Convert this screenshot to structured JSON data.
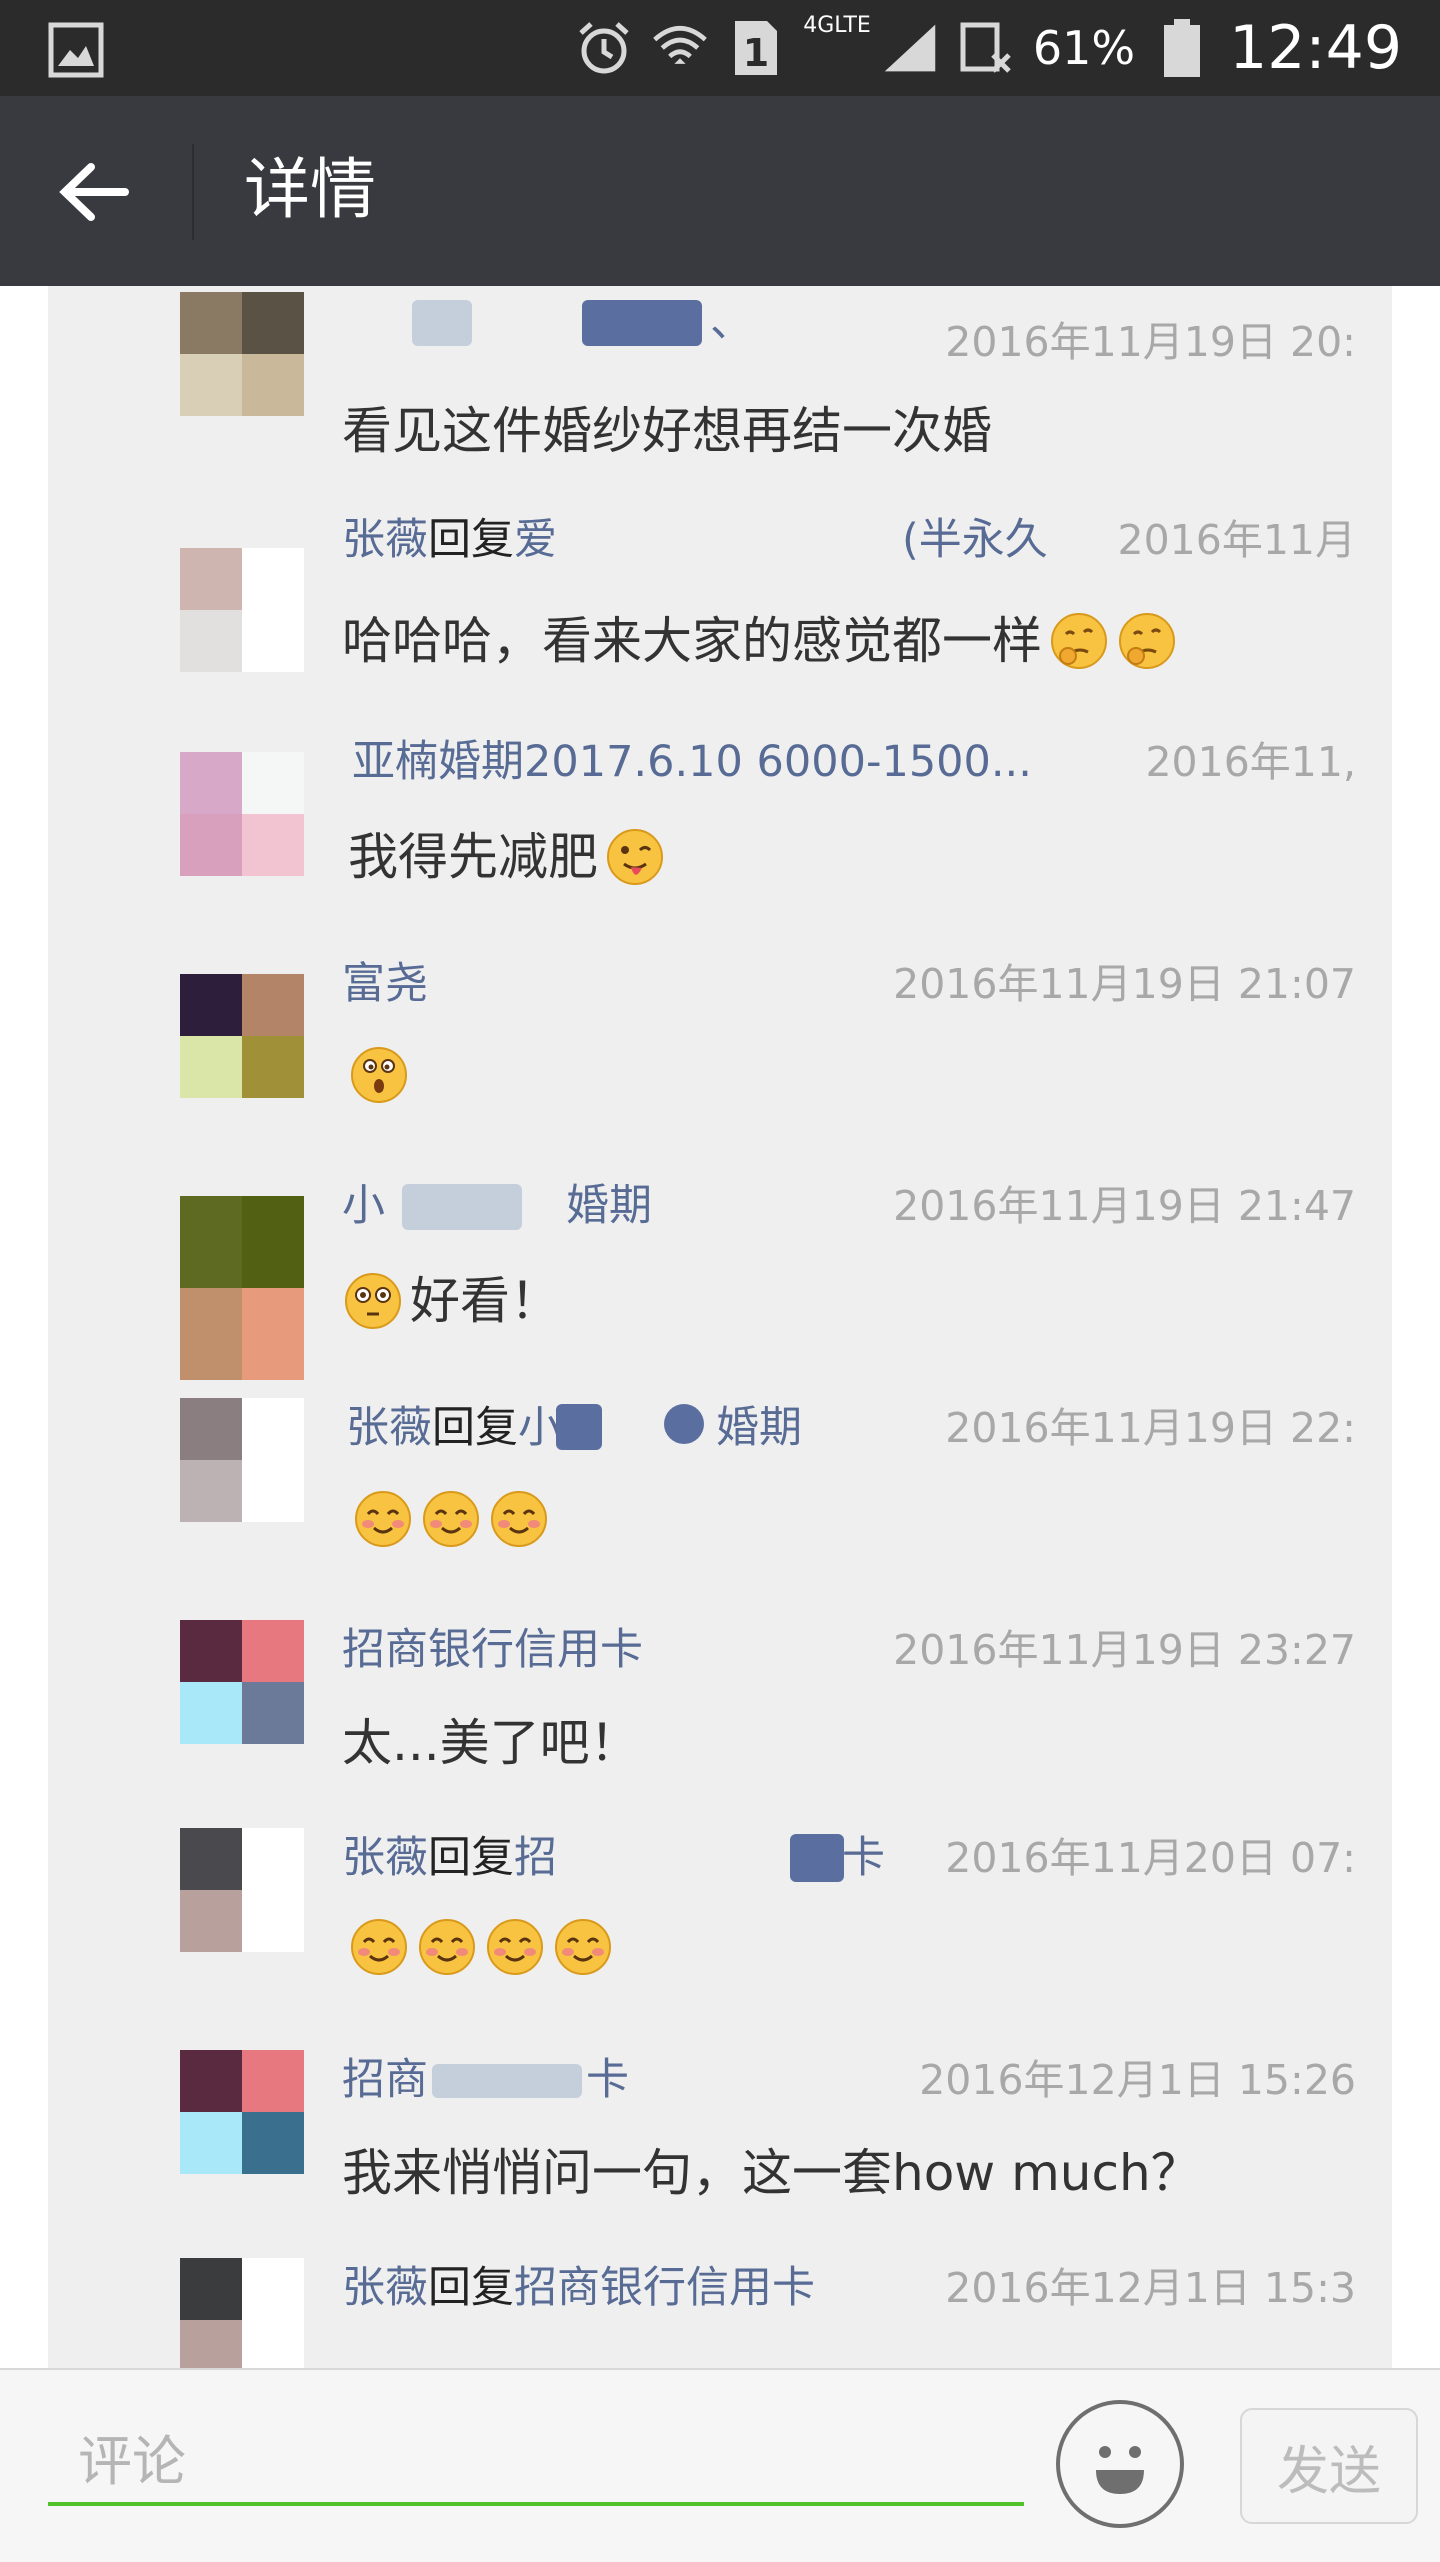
{
  "status_bar": {
    "sim_label": "1",
    "network_label": "4GLTE",
    "battery_percent": "61%",
    "time": "12:49"
  },
  "header": {
    "title": "详情"
  },
  "comments": [
    {
      "name": "",
      "reply_word": "",
      "reply_to": "、",
      "time": "2016年11月19日 20:",
      "text": "看见这件婚纱好想再结一次婚",
      "emojis": []
    },
    {
      "name": "张薇",
      "reply_word": "回复",
      "reply_to": "爱",
      "reply_to_tail": "(半永久",
      "time": "2016年11月",
      "text": "哈哈哈，看来大家的感觉都一样",
      "emojis": [
        "thinking-emoji",
        "thinking-emoji"
      ]
    },
    {
      "name": "亚楠婚期2017.6.10 6000-1500...",
      "reply_word": "",
      "reply_to": "",
      "time": "2016年11,",
      "text": "我得先减肥",
      "emojis": [
        "tongue-wink-emoji"
      ]
    },
    {
      "name": "富尧",
      "reply_word": "",
      "reply_to": "",
      "time": "2016年11月19日 21:07",
      "text": "",
      "emojis": [
        "surprised-emoji"
      ]
    },
    {
      "name": "小",
      "name_tail": "婚期",
      "reply_word": "",
      "reply_to": "",
      "time": "2016年11月19日 21:47",
      "text": "好看！",
      "emojis_before": [
        "flushed-emoji"
      ],
      "emojis": []
    },
    {
      "name": "张薇",
      "reply_word": "回复",
      "reply_to": "小",
      "reply_to_tail": "婚期",
      "time": "2016年11月19日 22:",
      "text": "",
      "emojis": [
        "blush-emoji",
        "blush-emoji",
        "blush-emoji"
      ]
    },
    {
      "name": "招商银行信用卡",
      "reply_word": "",
      "reply_to": "",
      "time": "2016年11月19日 23:27",
      "text": "太...美了吧！",
      "emojis": []
    },
    {
      "name": "张薇",
      "reply_word": "回复",
      "reply_to": "招",
      "reply_to_tail": "卡",
      "time": "2016年11月20日 07:",
      "text": "",
      "emojis": [
        "blush-emoji",
        "blush-emoji",
        "blush-emoji",
        "blush-emoji"
      ]
    },
    {
      "name": "招商",
      "name_tail": "卡",
      "reply_word": "",
      "reply_to": "",
      "time": "2016年12月1日 15:26",
      "text": "我来悄悄问一句，这一套how much？",
      "emojis": []
    },
    {
      "name": "张薇",
      "reply_word": "回复",
      "reply_to": "招商银行信用卡",
      "time": "2016年12月1日 15:3",
      "text": "",
      "emojis": []
    }
  ],
  "input_bar": {
    "placeholder": "评论",
    "send_label": "发送"
  },
  "colors": {
    "status_bar": "#2b2b2b",
    "title_bar": "#393a3f",
    "panel": "#efefef",
    "name_link": "#576b95",
    "timestamp": "#a8a8a8",
    "input_underline": "#4ec12b"
  }
}
